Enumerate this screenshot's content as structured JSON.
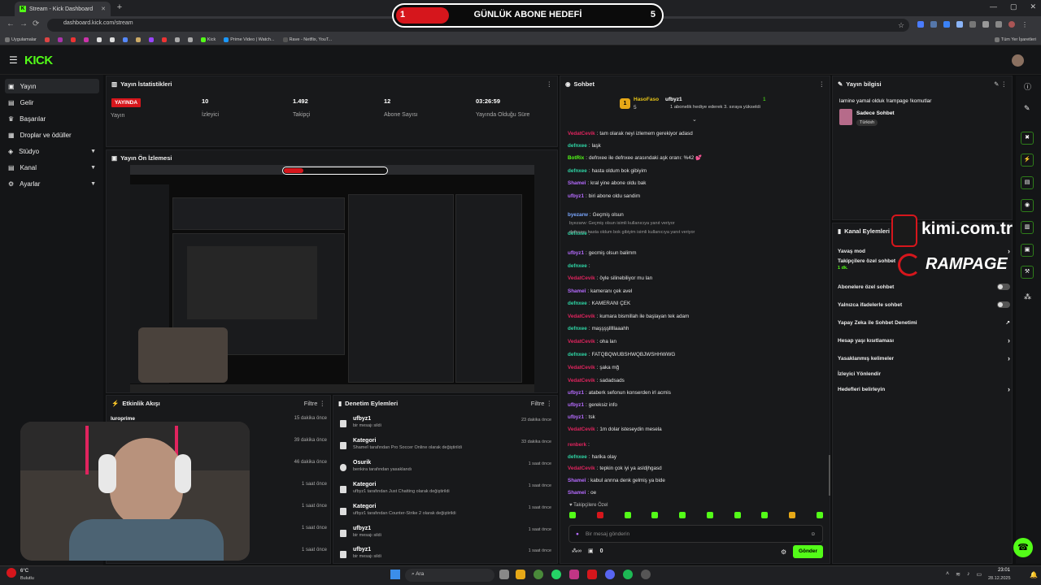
{
  "browser": {
    "tab_title": "Stream - Kick Dashboard",
    "url": "dashboard.kick.com/stream",
    "bookmarks": [
      "Uygulamalar",
      "Kick",
      "Prime Video | Watch...",
      "Rave - Netflix, YouT..."
    ],
    "all_bookmarks": "Tüm Yer İşaretleri"
  },
  "goal": {
    "current": "1",
    "title": "GÜNLÜK ABONE HEDEFİ",
    "target": "5",
    "progress_fraction": 0.2
  },
  "brand": {
    "logo": "KICK",
    "accent": "#53fc18"
  },
  "sidebar": {
    "items": [
      {
        "label": "Yayın",
        "icon": "broadcast-icon"
      },
      {
        "label": "Gelir",
        "icon": "money-icon"
      },
      {
        "label": "Başarılar",
        "icon": "trophy-icon"
      },
      {
        "label": "Droplar ve ödüller",
        "icon": "gift-icon"
      },
      {
        "label": "Stüdyo",
        "icon": "studio-icon"
      },
      {
        "label": "Kanal",
        "icon": "channel-icon"
      },
      {
        "label": "Ayarlar",
        "icon": "gear-icon"
      }
    ]
  },
  "stats": {
    "title": "Yayın İstatistikleri",
    "live_badge": "YAYINDA",
    "items": [
      {
        "value": "",
        "label": "Yayın"
      },
      {
        "value": "10",
        "label": "İzleyici"
      },
      {
        "value": "1.492",
        "label": "Takipçi"
      },
      {
        "value": "12",
        "label": "Abone Sayısı"
      },
      {
        "value": "03:26:59",
        "label": "Yayında Olduğu Süre"
      }
    ]
  },
  "preview": {
    "title": "Yayın Ön İzlemesi"
  },
  "events": {
    "title": "Etkinlik Akışı",
    "filter": "Filtre",
    "rows": [
      {
        "name": "luroprime",
        "time": "15 dakika önce"
      },
      {
        "name": "",
        "time": "39 dakika önce"
      },
      {
        "name": "",
        "time": "46 dakika önce"
      },
      {
        "name": "",
        "time": "1 saat önce"
      },
      {
        "name": "",
        "time": "1 saat önce"
      },
      {
        "name": "",
        "time": "1 saat önce"
      },
      {
        "name": "",
        "time": "1 saat önce"
      }
    ]
  },
  "moderation": {
    "title": "Denetim Eylemleri",
    "filter": "Filtre",
    "rows": [
      {
        "title": "ufbyz1",
        "sub": "bir mesajı sildi",
        "time": "23 dakika önce"
      },
      {
        "title": "Kategori",
        "sub": "Shameî tarafından Pro Soccer Online olarak değiştirildi",
        "time": "33 dakika önce"
      },
      {
        "title": "Osurik",
        "sub": "benkira tarafından yasaklandı",
        "time": "1 saat önce"
      },
      {
        "title": "Kategori",
        "sub": "ufbyz1 tarafından Just Chatting olarak değiştirildi",
        "time": "1 saat önce"
      },
      {
        "title": "Kategori",
        "sub": "ufbyz1 tarafından Counter-Strike 2 olarak değiştirildi",
        "time": "1 saat önce"
      },
      {
        "title": "ufbyz1",
        "sub": "bir mesajı sildi",
        "time": "1 saat önce"
      },
      {
        "title": "ufbyz1",
        "sub": "bir mesajı sildi",
        "time": "1 saat önce"
      }
    ]
  },
  "chat": {
    "title": "Sohbet",
    "pinned_left_name": "HasoFaso",
    "pinned_left_count": "5",
    "pinned_user": "ufbyz1",
    "pinned_count": "1",
    "pinned_text": "1 abonelik hediye ederek 3. sıraya yükseldi",
    "messages": [
      {
        "user": "VedatCevik",
        "color": "#e0245e",
        "text": "tam olarak neyi izlemem gerekiyor adasd"
      },
      {
        "user": "defnxee",
        "color": "#2fd6a6",
        "text": "laşk"
      },
      {
        "user": "BotRix",
        "color": "#53fc18",
        "text": "defnxee ile defnxee arasındaki aşk oranı: %42 💕"
      },
      {
        "user": "defnxee",
        "color": "#2fd6a6",
        "text": "hasta oldum bok gibiyim"
      },
      {
        "user": "Shameî",
        "color": "#b66bff",
        "text": "kral yine abone oldu bak"
      },
      {
        "user": "ufbyz1",
        "color": "#b66bff",
        "text": "biri abone oldu sandim"
      },
      {
        "user": "byezarw",
        "color": "#7aa7ff",
        "text": "Geçmiş olsun"
      },
      {
        "user": "defnxee",
        "color": "#2fd6a6",
        "text": ""
      },
      {
        "user": "ufbyz1",
        "color": "#b66bff",
        "text": "gecmiş olsun balimm"
      },
      {
        "user": "defnxee",
        "color": "#2fd6a6",
        "text": ""
      },
      {
        "user": "VedatCevik",
        "color": "#e0245e",
        "text": "öyle silinebiliyor mu lan"
      },
      {
        "user": "Shameî",
        "color": "#b66bff",
        "text": "kameranı çek avel"
      },
      {
        "user": "defnxee",
        "color": "#2fd6a6",
        "text": "KAMERANI ÇEK"
      },
      {
        "user": "VedatCevik",
        "color": "#e0245e",
        "text": "kumara bismillah ile başlayan tek adam"
      },
      {
        "user": "defnxee",
        "color": "#2fd6a6",
        "text": "maşşşşlllllaaahh"
      },
      {
        "user": "VedatCevik",
        "color": "#e0245e",
        "text": "oha lan"
      },
      {
        "user": "defnxee",
        "color": "#2fd6a6",
        "text": "FATQBQWUBSHWQBJWSHHWWG"
      },
      {
        "user": "VedatCevik",
        "color": "#e0245e",
        "text": "şaka mğ"
      },
      {
        "user": "VedatCevik",
        "color": "#e0245e",
        "text": "sadadsads"
      },
      {
        "user": "ufbyz1",
        "color": "#b66bff",
        "text": "ataberk sefonun konserden irl acmis"
      },
      {
        "user": "ufbyz1",
        "color": "#b66bff",
        "text": "gereksiz info"
      },
      {
        "user": "ufbyz1",
        "color": "#b66bff",
        "text": "tsk"
      },
      {
        "user": "VedatCevik",
        "color": "#e0245e",
        "text": "1m dolar isteseydin mesela"
      },
      {
        "user": "renberk",
        "color": "#e0245e",
        "text": ""
      },
      {
        "user": "defnxee",
        "color": "#2fd6a6",
        "text": "harika olay"
      },
      {
        "user": "VedatCevik",
        "color": "#e0245e",
        "text": "tepkin çok iyi ya asldjhgasd"
      },
      {
        "user": "Shameî",
        "color": "#b66bff",
        "text": "kabul annna denk gelmiş ya bide"
      },
      {
        "user": "Shameî",
        "color": "#b66bff",
        "text": "oe"
      }
    ],
    "reply_notes": [
      "defnxee: hasta oldum bok gibiyim isimli kullanıcıya yanıt veriyor",
      "byezarw: Geçmiş olsun isimli kullanıcıya yanıt veriyor",
      "defnxee: hasta oldum bok gibiyim isimli kullanıcıya yanıt veriyor"
    ],
    "followers_only": "Takipçilere Özel",
    "input_placeholder": "Bir mesaj gönderin",
    "send_label": "Gönder",
    "points": "0"
  },
  "stream_info": {
    "title": "Yayın bilgisi",
    "stream_title": "lamine yamal olduk !rampage !komutlar",
    "category": "Sadece Sohbet",
    "tag": "Türkish"
  },
  "channel_actions": {
    "title": "Kanal Eylemleri",
    "rows": [
      {
        "label": "Yavaş mod",
        "type": "chevron"
      },
      {
        "label": "Takipçilere özel sohbet",
        "sub": "1 dk.",
        "type": "toggle"
      },
      {
        "label": "Abonelere özel sohbet",
        "type": "toggle"
      },
      {
        "label": "Yalnızca ifadelerle sohbet",
        "type": "toggle"
      },
      {
        "label": "Yapay Zeka ile Sohbet Denetimi",
        "type": "ext"
      },
      {
        "label": "Hesap yaşı kısıtlaması",
        "type": "chevron"
      },
      {
        "label": "Yasaklanmış kelimeler",
        "type": "chevron"
      },
      {
        "label": "İzleyici Yönlendir",
        "type": "none"
      },
      {
        "label": "Hedefleri belirleyin",
        "type": "chevron"
      }
    ]
  },
  "overlay": {
    "site": "kimi.com.tr",
    "brand2": "RAMPAGE"
  },
  "taskbar": {
    "weather_temp": "6°C",
    "weather_desc": "Bulutlu",
    "search": "Ara",
    "time": "23:01",
    "date": "28.12.2025"
  }
}
